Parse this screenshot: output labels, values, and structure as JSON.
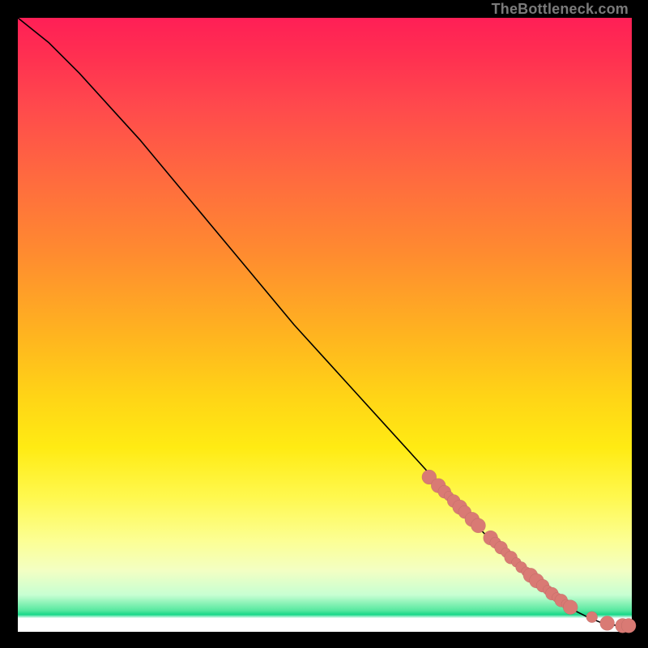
{
  "watermark": "TheBottleneck.com",
  "colors": {
    "point_fill": "#d97a74",
    "curve_stroke": "#000000"
  },
  "chart_data": {
    "type": "line",
    "title": "",
    "xlabel": "",
    "ylabel": "",
    "xlim": [
      0,
      100
    ],
    "ylim": [
      0,
      100
    ],
    "grid": false,
    "legend": false,
    "series": [
      {
        "name": "curve",
        "kind": "line",
        "x": [
          0,
          5,
          10,
          15,
          20,
          25,
          30,
          35,
          40,
          45,
          50,
          55,
          60,
          65,
          70,
          75,
          80,
          85,
          88,
          91,
          93,
          95,
          97,
          98.5,
          100
        ],
        "y": [
          100,
          96,
          91,
          85.5,
          80,
          74,
          68,
          62,
          56,
          50,
          44.5,
          39,
          33.5,
          28,
          22.5,
          17,
          12,
          7.5,
          5.2,
          3.3,
          2.3,
          1.5,
          1.1,
          1.0,
          1.0
        ]
      },
      {
        "name": "points",
        "kind": "scatter",
        "x": [
          67,
          68.5,
          69.5,
          70.2,
          71,
          72,
          72.8,
          74,
          75,
          77,
          77.8,
          78.7,
          79.5,
          80.3,
          81.2,
          82,
          82.8,
          83.5,
          84.5,
          85.5,
          86.3,
          87,
          87.8,
          88.5,
          89.3,
          90,
          93.5,
          96,
          98.5,
          99.5
        ],
        "y": [
          25.2,
          23.8,
          22.8,
          22.1,
          21.3,
          20.3,
          19.5,
          18.3,
          17.3,
          15.3,
          14.5,
          13.7,
          12.9,
          12.1,
          11.3,
          10.5,
          9.8,
          9.2,
          8.3,
          7.5,
          6.8,
          6.2,
          5.6,
          5.1,
          4.5,
          4.0,
          2.4,
          1.4,
          1.0,
          1.0
        ],
        "r": [
          9,
          9,
          8,
          6,
          8,
          9,
          8,
          9,
          9,
          9,
          7,
          8,
          6,
          8,
          6,
          7,
          6,
          9,
          9,
          8,
          6,
          8,
          6,
          8,
          6,
          9,
          7,
          9,
          9,
          9
        ]
      }
    ]
  }
}
